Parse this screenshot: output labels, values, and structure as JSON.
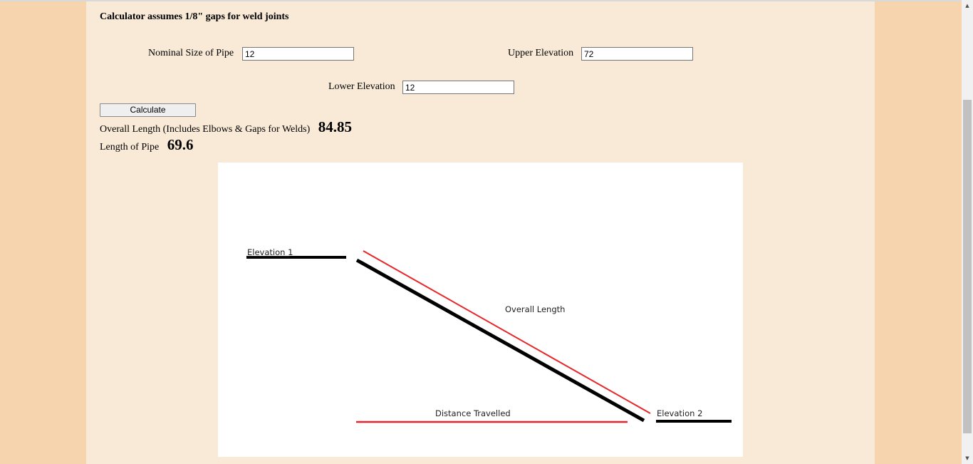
{
  "header": {
    "assumption_note": "Calculator assumes 1/8\" gaps for weld joints"
  },
  "form": {
    "nominal_size": {
      "label": "Nominal Size of Pipe",
      "value": "12"
    },
    "upper_elevation": {
      "label": "Upper Elevation",
      "value": "72"
    },
    "lower_elevation": {
      "label": "Lower Elevation",
      "value": "12"
    },
    "calculate_label": "Calculate"
  },
  "results": {
    "overall_length_label": "Overall Length (Includes Elbows & Gaps for Welds)",
    "overall_length_value": "84.85",
    "pipe_length_label": "Length of Pipe",
    "pipe_length_value": "69.6"
  },
  "diagram": {
    "elevation1_label": "Elevation 1",
    "elevation2_label": "Elevation 2",
    "overall_length_label": "Overall Length",
    "distance_travelled_label": "Distance Travelled",
    "colors": {
      "pipe": "#000000",
      "measure": "#e8262a"
    }
  },
  "scrollbar": {
    "up_icon": "scroll-up-arrow-icon",
    "down_icon": "scroll-down-arrow-icon"
  }
}
